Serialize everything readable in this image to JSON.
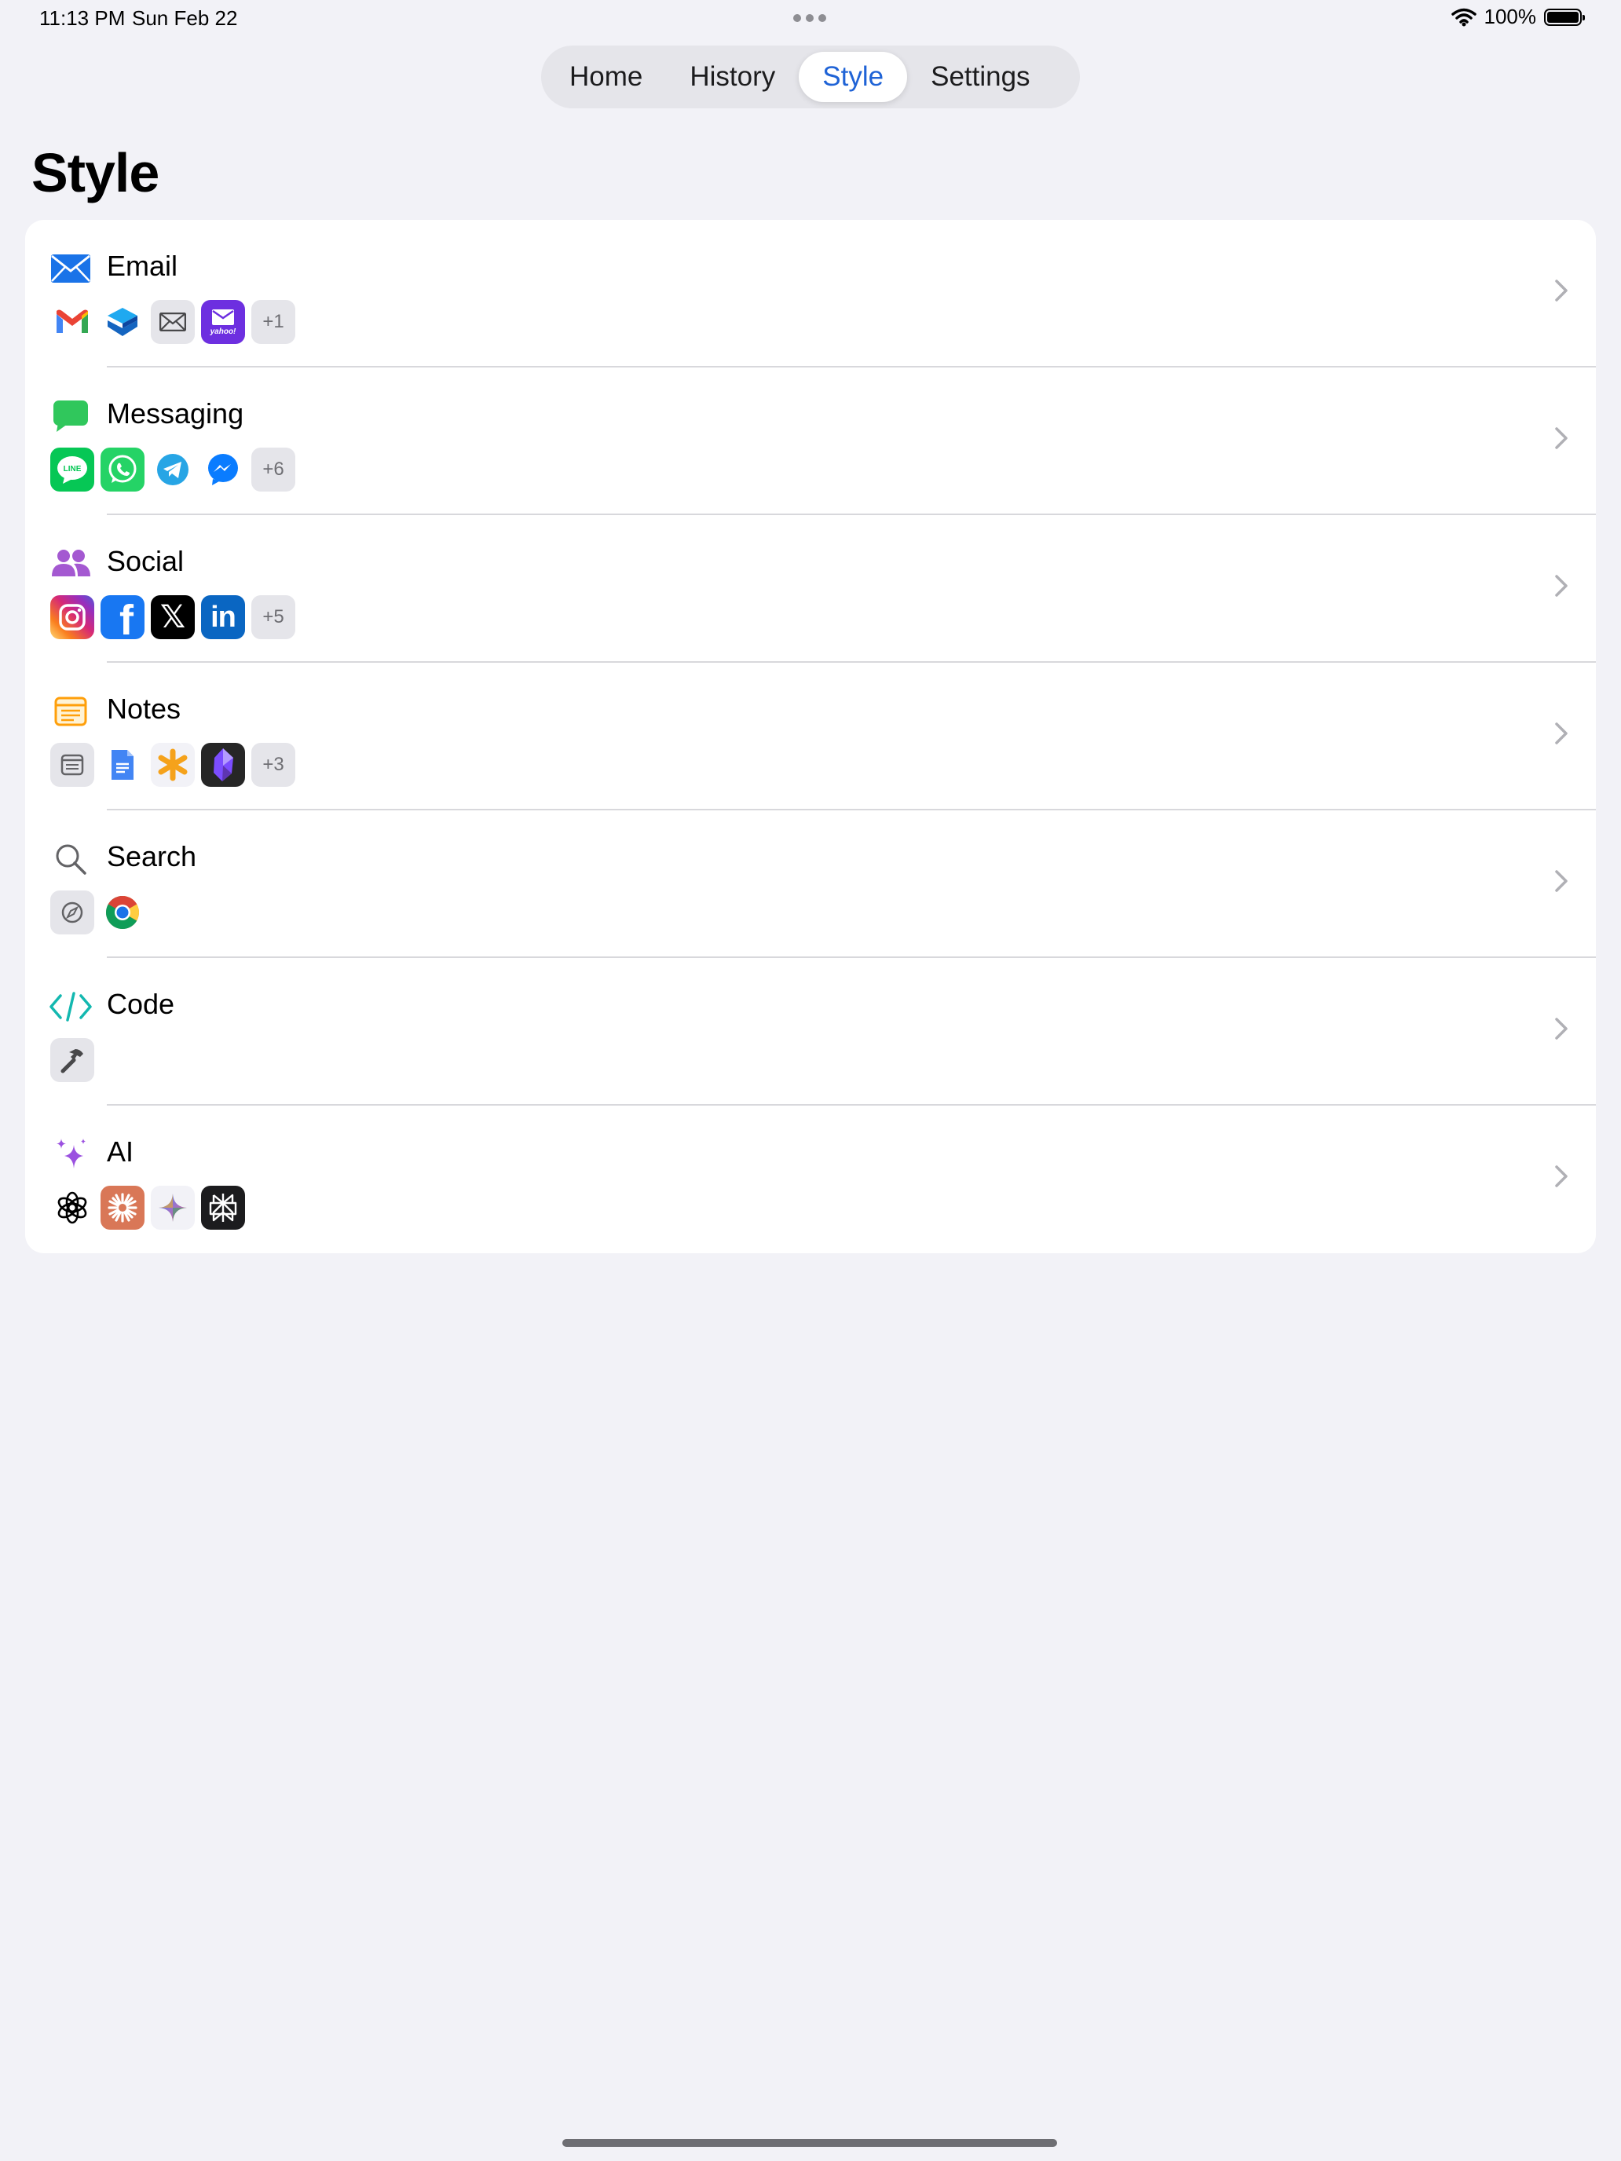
{
  "status_bar": {
    "time": "11:13 PM",
    "date": "Sun Feb 22",
    "battery": "100%"
  },
  "tabs": [
    {
      "label": "Home",
      "active": false
    },
    {
      "label": "History",
      "active": false
    },
    {
      "label": "Style",
      "active": true
    },
    {
      "label": "Settings",
      "active": false
    }
  ],
  "page_title": "Style",
  "accent_color": "#1f63d6",
  "categories": [
    {
      "label": "Email",
      "icon": "envelope-icon",
      "apps": [
        "gmail-icon",
        "spark-mail-icon",
        "mail-icon",
        "yahoo-mail-icon"
      ],
      "more": "+1"
    },
    {
      "label": "Messaging",
      "icon": "message-bubble-icon",
      "apps": [
        "line-icon",
        "whatsapp-icon",
        "telegram-icon",
        "messenger-icon"
      ],
      "more": "+6"
    },
    {
      "label": "Social",
      "icon": "people-icon",
      "apps": [
        "instagram-icon",
        "facebook-icon",
        "x-icon",
        "linkedin-icon"
      ],
      "more": "+5"
    },
    {
      "label": "Notes",
      "icon": "notes-icon",
      "apps": [
        "notes-app-icon",
        "google-docs-icon",
        "asterisk-notes-icon",
        "obsidian-icon"
      ],
      "more": "+3"
    },
    {
      "label": "Search",
      "icon": "magnifier-icon",
      "apps": [
        "safari-icon",
        "chrome-icon"
      ],
      "more": ""
    },
    {
      "label": "Code",
      "icon": "code-brackets-icon",
      "apps": [
        "xcode-hammer-icon"
      ],
      "more": ""
    },
    {
      "label": "AI",
      "icon": "sparkles-icon",
      "apps": [
        "chatgpt-icon",
        "claude-icon",
        "gemini-icon",
        "perplexity-icon"
      ],
      "more": ""
    }
  ],
  "app_logo_text": {
    "yahoo": "yahoo!",
    "line": "LINE",
    "facebook": "f",
    "linkedin": "in",
    "x": "𝕏"
  }
}
